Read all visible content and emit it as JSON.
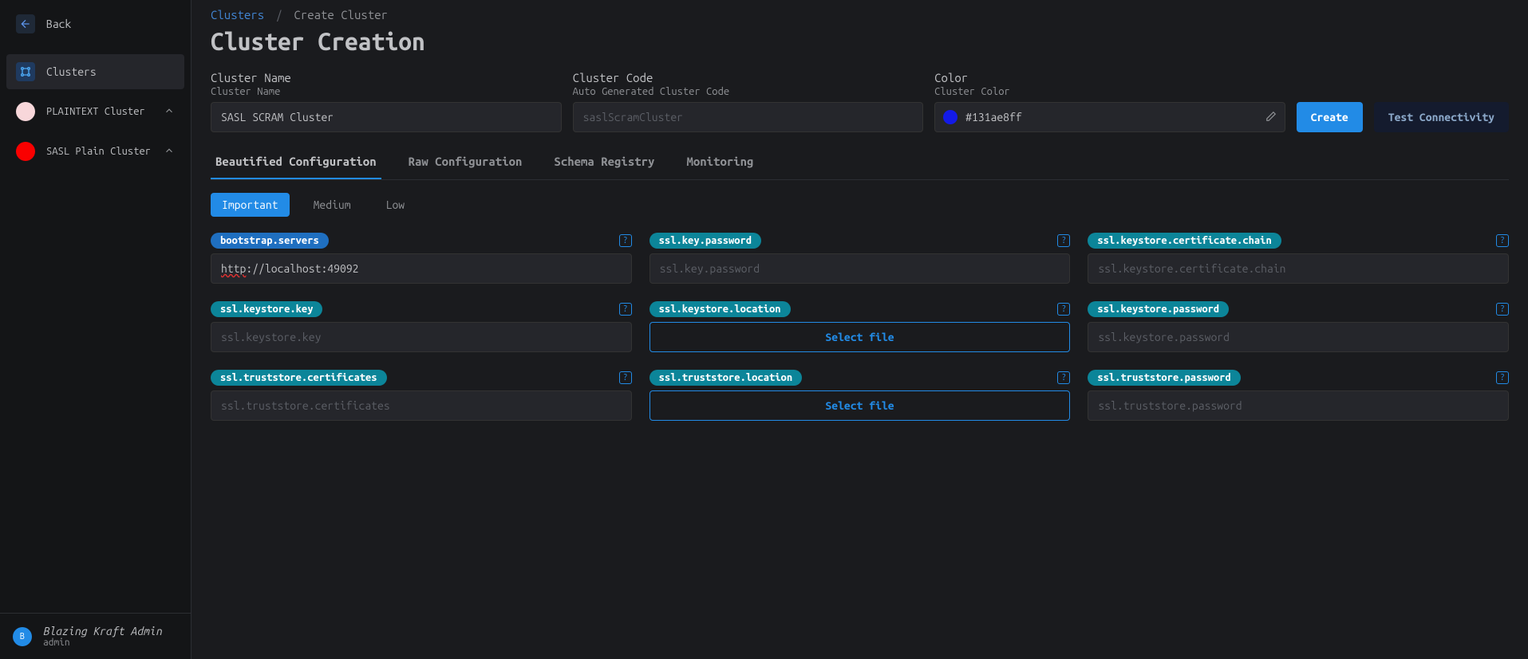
{
  "sidebar": {
    "back": "Back",
    "nav": {
      "clusters": "Clusters"
    },
    "clusters": [
      {
        "label": "PLAINTEXT Cluster",
        "color": "#f8d7da"
      },
      {
        "label": "SASL Plain Cluster",
        "color": "#fa0000"
      }
    ],
    "user": {
      "name": "Blazing Kraft Admin",
      "role": "admin",
      "initial": "B"
    }
  },
  "breadcrumb": {
    "root": "Clusters",
    "current": "Create Cluster"
  },
  "page_title": "Cluster Creation",
  "form": {
    "name_label": "Cluster Name",
    "name_sub": "Cluster Name",
    "name_value": "SASL SCRAM Cluster",
    "code_label": "Cluster Code",
    "code_sub": "Auto Generated Cluster Code",
    "code_placeholder": "saslScramCluster",
    "color_label": "Color",
    "color_sub": "Cluster Color",
    "color_value": "#131ae8ff",
    "color_hex": "#131ae8"
  },
  "buttons": {
    "create": "Create",
    "test": "Test Connectivity",
    "select_file": "Select file"
  },
  "tabs": [
    {
      "label": "Beautified Configuration",
      "active": true
    },
    {
      "label": "Raw Configuration",
      "active": false
    },
    {
      "label": "Schema Registry",
      "active": false
    },
    {
      "label": "Monitoring",
      "active": false
    }
  ],
  "priority": [
    {
      "label": "Important",
      "active": true
    },
    {
      "label": "Medium",
      "active": false
    },
    {
      "label": "Low",
      "active": false
    }
  ],
  "config": [
    {
      "key": "bootstrap.servers",
      "badge": "blue",
      "type": "text",
      "value": "http://localhost:49092",
      "placeholder": ""
    },
    {
      "key": "ssl.key.password",
      "badge": "teal",
      "type": "text",
      "value": "",
      "placeholder": "ssl.key.password"
    },
    {
      "key": "ssl.keystore.certificate.chain",
      "badge": "teal",
      "type": "text",
      "value": "",
      "placeholder": "ssl.keystore.certificate.chain"
    },
    {
      "key": "ssl.keystore.key",
      "badge": "teal",
      "type": "text",
      "value": "",
      "placeholder": "ssl.keystore.key"
    },
    {
      "key": "ssl.keystore.location",
      "badge": "teal",
      "type": "file",
      "value": "",
      "placeholder": ""
    },
    {
      "key": "ssl.keystore.password",
      "badge": "teal",
      "type": "text",
      "value": "",
      "placeholder": "ssl.keystore.password"
    },
    {
      "key": "ssl.truststore.certificates",
      "badge": "teal",
      "type": "text",
      "value": "",
      "placeholder": "ssl.truststore.certificates"
    },
    {
      "key": "ssl.truststore.location",
      "badge": "teal",
      "type": "file",
      "value": "",
      "placeholder": ""
    },
    {
      "key": "ssl.truststore.password",
      "badge": "teal",
      "type": "text",
      "value": "",
      "placeholder": "ssl.truststore.password"
    }
  ]
}
